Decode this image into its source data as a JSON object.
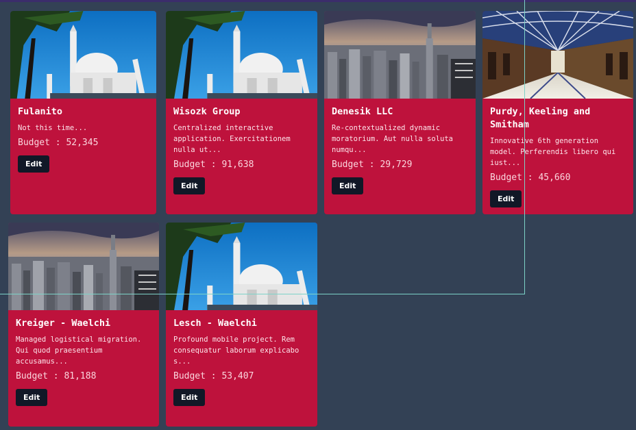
{
  "cards": [
    {
      "name": "Fulanito",
      "description": "Not this time...",
      "budget": "Budget : 52,345",
      "edit_label": "Edit",
      "image": "taj-mahal-image"
    },
    {
      "name": "Wisozk Group",
      "description": "Centralized interactive application. Exercitationem nulla ut...",
      "budget": "Budget : 91,638",
      "edit_label": "Edit",
      "image": "taj-mahal-image"
    },
    {
      "name": "Denesik LLC",
      "description": "Re-contextualized dynamic moratorium. Aut nulla soluta numqu...",
      "budget": "Budget : 29,729",
      "edit_label": "Edit",
      "image": "city-skyline-image"
    },
    {
      "name": "Purdy, Keeling and Smitham",
      "description": "Innovative 6th generation model. Perferendis libero qui iust...",
      "budget": "Budget : 45,660",
      "edit_label": "Edit",
      "image": "arcade-hall-image"
    },
    {
      "name": "Kreiger - Waelchi",
      "description": "Managed logistical migration. Qui quod praesentium accusamus...",
      "budget": "Budget : 81,188",
      "edit_label": "Edit",
      "image": "city-skyline-image"
    },
    {
      "name": "Lesch - Waelchi",
      "description": "Profound mobile project. Rem consequatur laborum explicabo s...",
      "budget": "Budget : 53,407",
      "edit_label": "Edit",
      "image": "taj-mahal-image"
    }
  ],
  "colors": {
    "background": "#334155",
    "card": "#be123c",
    "button": "#111827"
  }
}
